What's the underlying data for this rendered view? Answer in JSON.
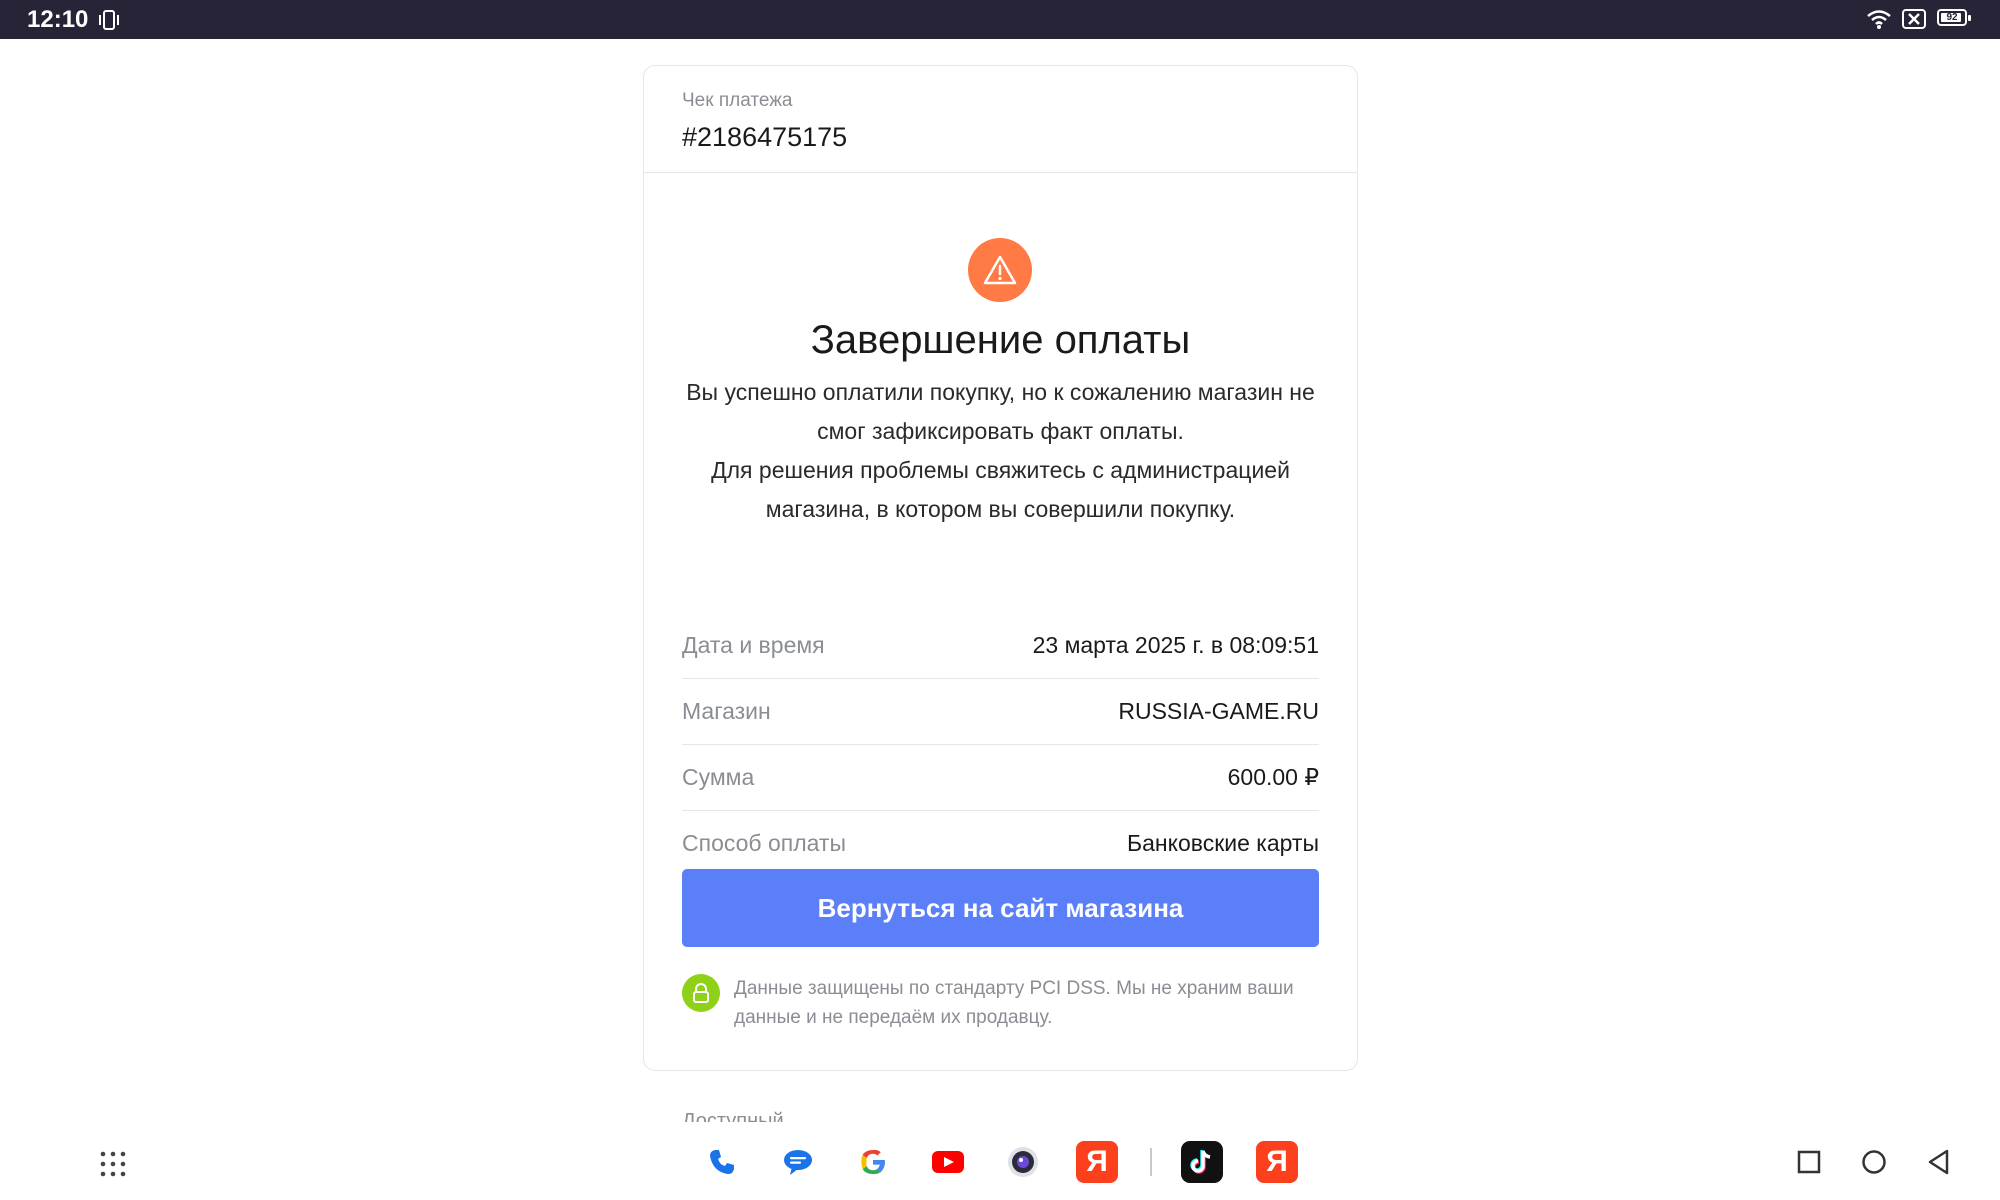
{
  "status_bar": {
    "time": "12:10",
    "battery": "92",
    "battery_level": 0.92,
    "icons": [
      "vibrate-icon",
      "wifi-icon",
      "no-sim-icon",
      "battery-icon"
    ]
  },
  "receipt": {
    "label": "Чек платежа",
    "number": "#2186475175"
  },
  "status": {
    "icon": "warning-icon",
    "title": "Завершение оплаты",
    "line1": "Вы успешно оплатили покупку, но к сожалению магазин не смог зафиксировать факт оплаты.",
    "line2": "Для решения проблемы свяжитесь с администрацией магазина, в котором вы совершили покупку."
  },
  "details": [
    {
      "label": "Дата и время",
      "value": "23 марта 2025 г. в 08:09:51"
    },
    {
      "label": "Магазин",
      "value": "RUSSIA-GAME.RU"
    },
    {
      "label": "Сумма",
      "value": "600.00 ₽"
    },
    {
      "label": "Способ оплаты",
      "value": "Банковские карты"
    }
  ],
  "cta": {
    "label": "Вернуться на сайт магазина"
  },
  "security": {
    "icon": "lock-icon",
    "text": "Данные защищены по стандарту PCI DSS. Мы не храним ваши данные и не передаём их продавцу."
  },
  "below_card_text": "Доступный",
  "dock": {
    "apps": [
      "phone-icon",
      "messages-icon",
      "google-icon",
      "youtube-icon",
      "camera-icon",
      "yandex-icon",
      "tiktok-icon",
      "yandex-browser-icon"
    ],
    "yandex_glyph": "Я"
  },
  "colors": {
    "status_bar": "#262436",
    "warning": "#ff7a45",
    "primary_button": "#5b7ff8",
    "secure_badge": "#8fd119"
  }
}
